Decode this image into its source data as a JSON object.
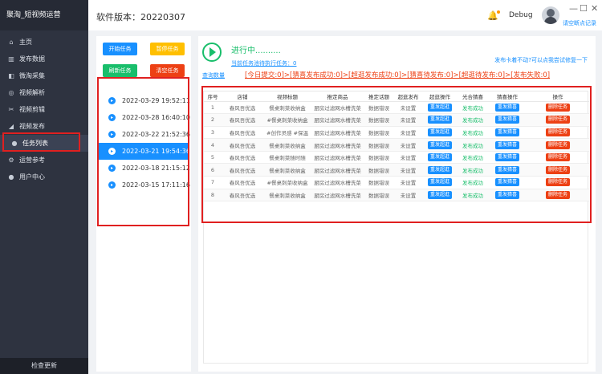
{
  "app": {
    "title": "聚淘_短视频运营"
  },
  "header": {
    "version": "软件版本：20220307",
    "user": "Debug",
    "clear_cache": "请空断点记录"
  },
  "sidebar": {
    "items": [
      {
        "label": "主页",
        "icon": "home-icon",
        "glyph": "⌂"
      },
      {
        "label": "发布数据",
        "icon": "bar-chart-icon",
        "glyph": "▥"
      },
      {
        "label": "微淘采集",
        "icon": "collect-icon",
        "glyph": "◧"
      },
      {
        "label": "视频解析",
        "icon": "circle-icon",
        "glyph": "◎"
      },
      {
        "label": "视频剪辑",
        "icon": "scissors-icon",
        "glyph": "✂"
      },
      {
        "label": "视频发布",
        "icon": "send-icon",
        "glyph": "◢"
      },
      {
        "label": "任务列表",
        "icon": "user-icon",
        "glyph": "●"
      },
      {
        "label": "运营参考",
        "icon": "gear-icon",
        "glyph": "⚙"
      },
      {
        "label": "用户中心",
        "icon": "user-icon",
        "glyph": "●"
      }
    ],
    "active_index": 6,
    "check_update": "检查更新"
  },
  "left_panel": {
    "start": "开始任务",
    "pause": "暂停任务",
    "refresh": "刷新任务",
    "clear": "清空任务",
    "tasks": [
      "2022-03-29 19:52:11",
      "2022-03-28 16:40:10",
      "2022-03-22 21:52:36",
      "2022-03-21 19:54:36",
      "2022-03-18 21:15:12",
      "2022-03-15 17:11:16"
    ],
    "selected_index": 3
  },
  "status": {
    "title": "进行中..........",
    "sub": "当前任务池待执行任务：0",
    "hint": "发布卡着不动?可以点我尝试修复一下",
    "query": "查询数量",
    "stats": "[今日提交:0]>[猜喜发布成功:0]>[超逛发布成功:0]>[猜喜待发布:0]>[超逛待发布:0]>[发布失败:0]"
  },
  "table": {
    "columns": [
      "序号",
      "店铺",
      "视频标题",
      "推定商品",
      "推定话题",
      "超逛发布",
      "超逛操作",
      "光合猜喜",
      "猜喜操作",
      "操作"
    ],
    "rows": [
      [
        "1",
        "春风吾优选",
        "餐桌刺菜收纳盒",
        "厨房过滤网水槽洗菜",
        "数据错误",
        "未设置",
        "重发超逛",
        "发布成功",
        "重发猜喜",
        "删除任务"
      ],
      [
        "2",
        "春风吾优选",
        "#餐桌刺菜收纳盒",
        "厨房过滤网水槽洗菜",
        "数据错误",
        "未设置",
        "重发超逛",
        "发布成功",
        "重发猜喜",
        "删除任务"
      ],
      [
        "3",
        "春风吾优选",
        "#创作灵感 #保温",
        "厨房过滤网水槽洗菜",
        "数据错误",
        "未设置",
        "重发超逛",
        "发布成功",
        "重发猜喜",
        "删除任务"
      ],
      [
        "4",
        "春风吾优选",
        "餐桌刺菜收纳盒",
        "厨房过滤网水槽洗菜",
        "数据错误",
        "未设置",
        "重发超逛",
        "发布成功",
        "重发猜喜",
        "删除任务"
      ],
      [
        "5",
        "春风吾优选",
        "餐桌刺菜随时随",
        "厨房过滤网水槽洗菜",
        "数据错误",
        "未设置",
        "重发超逛",
        "发布成功",
        "重发猜喜",
        "删除任务"
      ],
      [
        "6",
        "春风吾优选",
        "餐桌刺菜收纳盒",
        "厨房过滤网水槽洗菜",
        "数据错误",
        "未设置",
        "重发超逛",
        "发布成功",
        "重发猜喜",
        "删除任务"
      ],
      [
        "7",
        "春风吾优选",
        "#餐桌刺菜收纳盒",
        "厨房过滤网水槽洗菜",
        "数据错误",
        "未设置",
        "重发超逛",
        "发布成功",
        "重发猜喜",
        "删除任务"
      ],
      [
        "8",
        "春风吾优选",
        "餐桌刺菜收纳盒",
        "厨房过滤网水槽洗菜",
        "数据错误",
        "未设置",
        "重发超逛",
        "发布成功",
        "重发猜喜",
        "删除任务"
      ]
    ]
  },
  "colors": {
    "primary": "#1890ff",
    "success": "#19be6b",
    "warning": "#ffbf00",
    "danger": "#ed4014",
    "sidebar_bg": "#2e3340",
    "highlight_box": "#e02020"
  }
}
